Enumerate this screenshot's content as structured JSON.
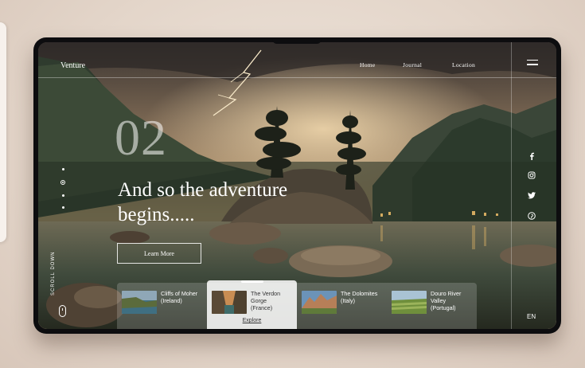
{
  "header": {
    "brand": "Venture",
    "nav": [
      "Home",
      "Journal",
      "Location"
    ]
  },
  "hero": {
    "number": "02",
    "headline_line1": "And so the adventure",
    "headline_line2": "begins.....",
    "cta_label": "Learn More"
  },
  "sidebar": {
    "scroll_label": "SCROLL DOWN",
    "active_dot": 2,
    "dot_count": 4
  },
  "social_icons": [
    "facebook-icon",
    "instagram-icon",
    "twitter-icon",
    "pinterest-icon"
  ],
  "language": "EN",
  "destinations": [
    {
      "name_line1": "Cliffs of Moher",
      "name_line2": "(Ireland)",
      "name_line3": ""
    },
    {
      "name_line1": "The Verdon",
      "name_line2": "Gorge",
      "name_line3": "(France)"
    },
    {
      "name_line1": "The Dolomites",
      "name_line2": "(Italy)",
      "name_line3": ""
    },
    {
      "name_line1": "Douro River",
      "name_line2": "Valley",
      "name_line3": "(Portugal)"
    }
  ],
  "explore_label": "Explore",
  "colors": {
    "background": "#e8dcd2",
    "device": "#0d0d0f",
    "text": "#ffffff",
    "sky_warm": "#c9a77a"
  }
}
